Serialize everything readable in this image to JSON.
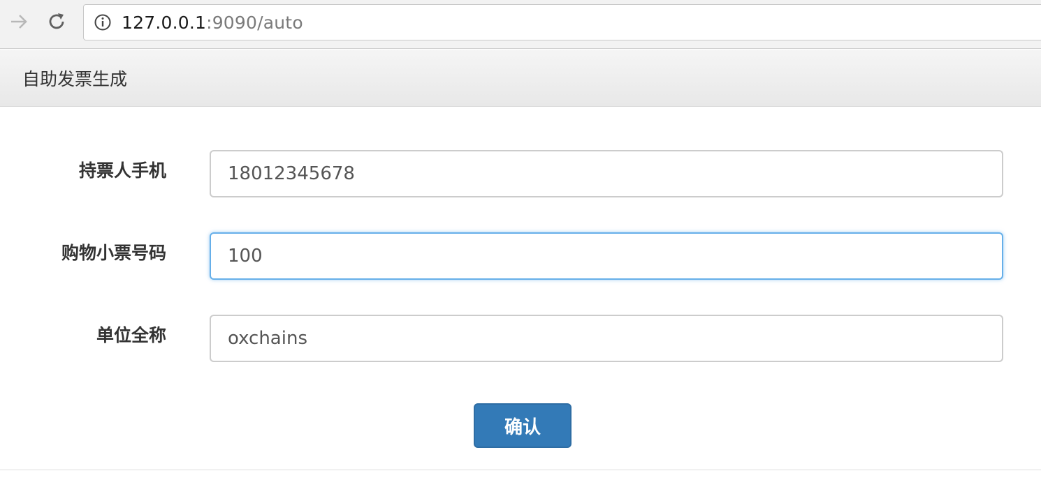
{
  "browser": {
    "url_host": "127.0.0.1",
    "url_rest": ":9090/auto"
  },
  "panel": {
    "title": "自助发票生成"
  },
  "form": {
    "phone": {
      "label": "持票人手机",
      "value": "18012345678"
    },
    "receipt_number": {
      "label": "购物小票号码",
      "value": "100"
    },
    "company_name": {
      "label": "单位全称",
      "value": "oxchains"
    },
    "submit_label": "确认"
  },
  "colors": {
    "primary_button": "#337ab7",
    "focus_border": "#66afe9"
  }
}
